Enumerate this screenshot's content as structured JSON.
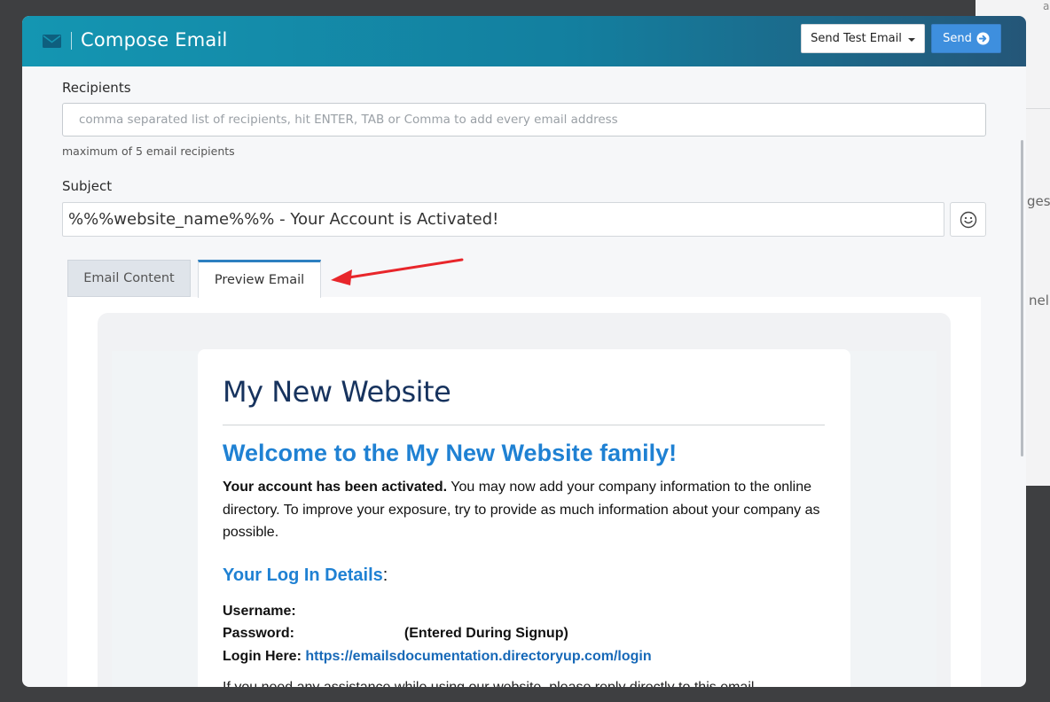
{
  "background": {
    "frag_ges": "ges",
    "frag_nel": "nel",
    "frag_top": "a"
  },
  "modal": {
    "title": "Compose Email",
    "send_test_label": "Send Test Email",
    "send_label": "Send"
  },
  "recipients": {
    "label": "Recipients",
    "placeholder": "comma separated list of recipients, hit ENTER, TAB or Comma to add every email address",
    "value": "",
    "help": "maximum of 5 email recipients"
  },
  "subject": {
    "label": "Subject",
    "value": "%%%website_name%%% - Your Account is Activated!"
  },
  "tabs": [
    {
      "label": "Email Content",
      "active": false
    },
    {
      "label": "Preview Email",
      "active": true
    }
  ],
  "email": {
    "brand": "My New Website",
    "welcome": "Welcome to the My New Website family!",
    "para_bold": "Your account has been activated.",
    "para_rest": " You may now add your company information to the online directory. To improve your exposure, try to provide as much information about your company as possible.",
    "login_heading": "Your Log In Details",
    "login_colon": ":",
    "username_label": "Username:",
    "password_label": "Password:",
    "password_note": "(Entered During Signup)",
    "login_label": "Login Here:",
    "login_url": "https://emailsdocumentation.directoryup.com/login",
    "trailing_text": "If you need any assistance while using our website, please reply directly to this email."
  },
  "colors": {
    "header_start": "#1496b2",
    "header_end": "#245678",
    "send_button": "#3e8fde",
    "email_brand": "#17335e",
    "email_heading": "#1f81d3",
    "annotation_arrow": "#e8262b"
  }
}
